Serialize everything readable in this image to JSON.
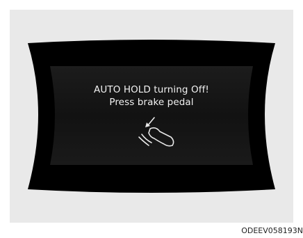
{
  "display": {
    "message_line1": "AUTO HOLD turning Off!",
    "message_line2": "Press brake pedal",
    "icon": "brake-pedal-press-icon"
  },
  "figure_code": "ODEEV058193N",
  "colors": {
    "background": "#e9e9e9",
    "display_black": "#000000",
    "display_panel": "#141414",
    "text": "#f2f2f2"
  }
}
